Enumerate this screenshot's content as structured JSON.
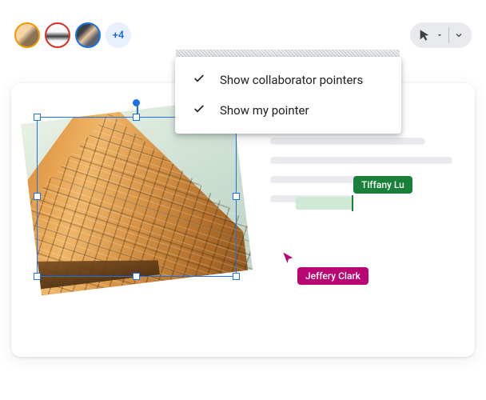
{
  "avatars": {
    "more_count": "+4"
  },
  "pointer_menu": {
    "items": [
      {
        "label": "Show collaborator pointers",
        "checked": true
      },
      {
        "label": "Show my pointer",
        "checked": true
      }
    ]
  },
  "collaborators": {
    "green": {
      "name": "Tiffany Lu",
      "color": "#188038"
    },
    "magenta": {
      "name": "Jeffery Clark",
      "color": "#b80672"
    }
  }
}
